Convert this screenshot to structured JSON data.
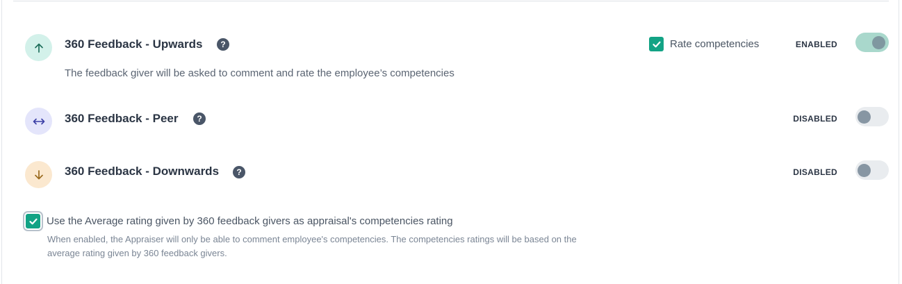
{
  "options": [
    {
      "title": "360 Feedback - Upwards",
      "description": "The feedback giver will be asked to comment and rate the employee’s competencies",
      "status": "ENABLED",
      "rate_competencies_label": "Rate competencies",
      "icon": "arrow-up-icon",
      "icon_bg": "#d3f1ea",
      "icon_color": "#1f6f5c"
    },
    {
      "title": "360 Feedback - Peer",
      "status": "DISABLED",
      "icon": "arrow-left-right-icon",
      "icon_bg": "#e4e5fb",
      "icon_color": "#3b3fa6"
    },
    {
      "title": "360 Feedback - Downwards",
      "status": "DISABLED",
      "icon": "arrow-down-icon",
      "icon_bg": "#fbe8cf",
      "icon_color": "#9a6a1d"
    }
  ],
  "help_glyph": "?",
  "average_rating": {
    "label": "Use the Average rating given by 360 feedback givers as appraisal's competencies rating",
    "help_line1": "When enabled, the Appraiser will only be able to comment employee's competencies. The competencies ratings will be based on the",
    "help_line2": "average rating given by 360 feedback givers."
  },
  "colors": {
    "accent": "#13a385",
    "toggle_on": "#a9d8cc",
    "toggle_off": "#e9ecef"
  }
}
